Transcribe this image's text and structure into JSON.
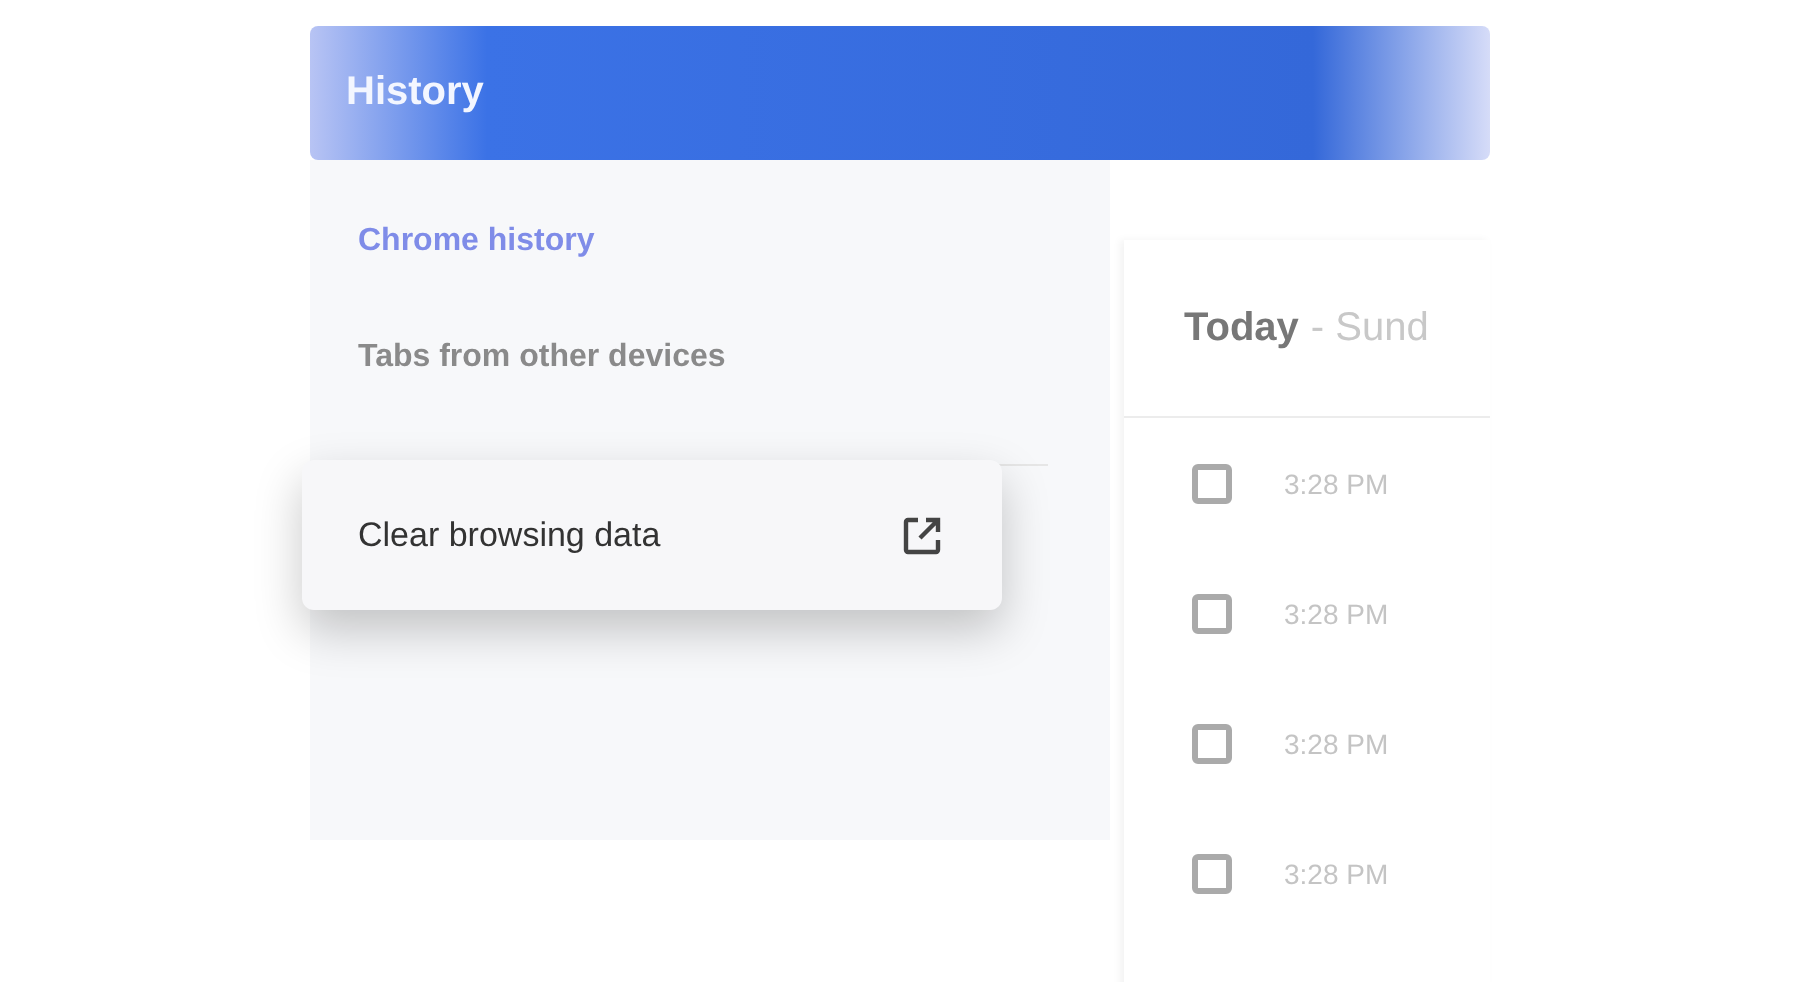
{
  "header": {
    "title": "History"
  },
  "sidebar": {
    "items": [
      {
        "label": "Chrome history",
        "selected": true
      },
      {
        "label": "Tabs from other devices",
        "selected": false
      }
    ]
  },
  "menu_card": {
    "label": "Clear browsing data"
  },
  "content": {
    "title": "Today",
    "subtitle": "- Sund",
    "rows": [
      {
        "time": "3:28 PM",
        "checked": false
      },
      {
        "time": "3:28 PM",
        "checked": false
      },
      {
        "time": "3:28 PM",
        "checked": false
      },
      {
        "time": "3:28 PM",
        "checked": false
      }
    ]
  }
}
